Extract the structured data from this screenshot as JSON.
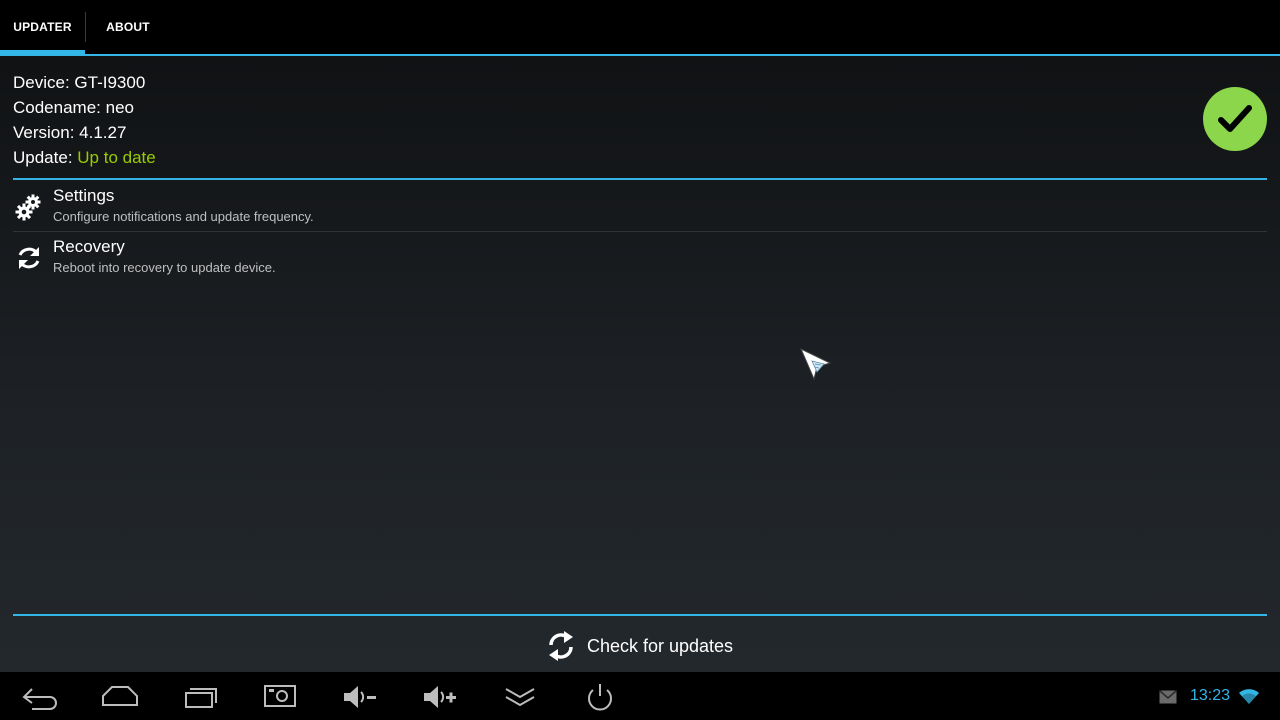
{
  "tabs": [
    {
      "label": "UPDATER",
      "selected": true
    },
    {
      "label": "ABOUT",
      "selected": false
    }
  ],
  "device_info": {
    "device_label": "Device:",
    "device_value": "GT-I9300",
    "codename_label": "Codename:",
    "codename_value": "neo",
    "version_label": "Version:",
    "version_value": "4.1.27",
    "update_label": "Update:",
    "update_value": "Up to date",
    "status_icon": "check-icon"
  },
  "list": [
    {
      "title": "Settings",
      "summary": "Configure notifications and update frequency.",
      "icon": "gears-icon"
    },
    {
      "title": "Recovery",
      "summary": "Reboot into recovery to update device.",
      "icon": "reboot-icon"
    }
  ],
  "action": {
    "label": "Check for updates",
    "icon": "refresh-icon"
  },
  "system_bar": {
    "nav_icons": [
      "back-icon",
      "home-icon",
      "recents-icon",
      "screenshot-icon",
      "volume-down-icon",
      "volume-up-icon",
      "collapse-icon",
      "power-icon"
    ],
    "clock": "13:23"
  },
  "colors": {
    "accent": "#33b5e5",
    "status_ok": "#99cc00",
    "badge": "#8bd64a"
  }
}
